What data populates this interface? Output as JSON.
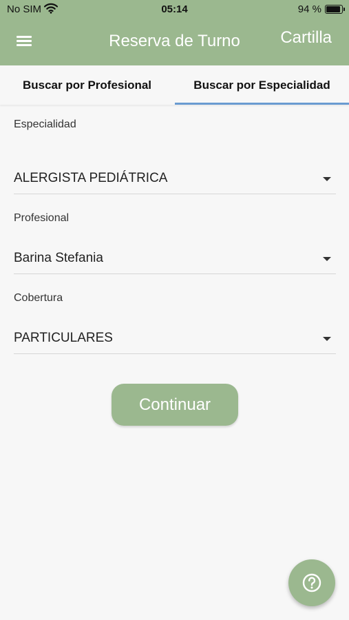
{
  "status_bar": {
    "carrier": "No SIM",
    "time": "05:14",
    "battery_percent_label": "94 %",
    "battery_level": 0.94
  },
  "header": {
    "menu_icon": "hamburger-menu-icon",
    "title": "Reserva de Turno",
    "cartilla_label": "Cartilla",
    "color": "#9bb88f"
  },
  "tabs": [
    {
      "label": "Buscar por Profesional",
      "active": false
    },
    {
      "label": "Buscar por Especialidad",
      "active": true
    }
  ],
  "tab_indicator_color": "#6a9bd1",
  "form": {
    "especialidad": {
      "label": "Especialidad",
      "value": "ALERGISTA PEDIÁTRICA"
    },
    "profesional": {
      "label": "Profesional",
      "value": "Barina Stefania"
    },
    "cobertura": {
      "label": "Cobertura",
      "value": "PARTICULARES"
    }
  },
  "continue_label": "Continuar",
  "help_fab_icon": "help-question-icon"
}
